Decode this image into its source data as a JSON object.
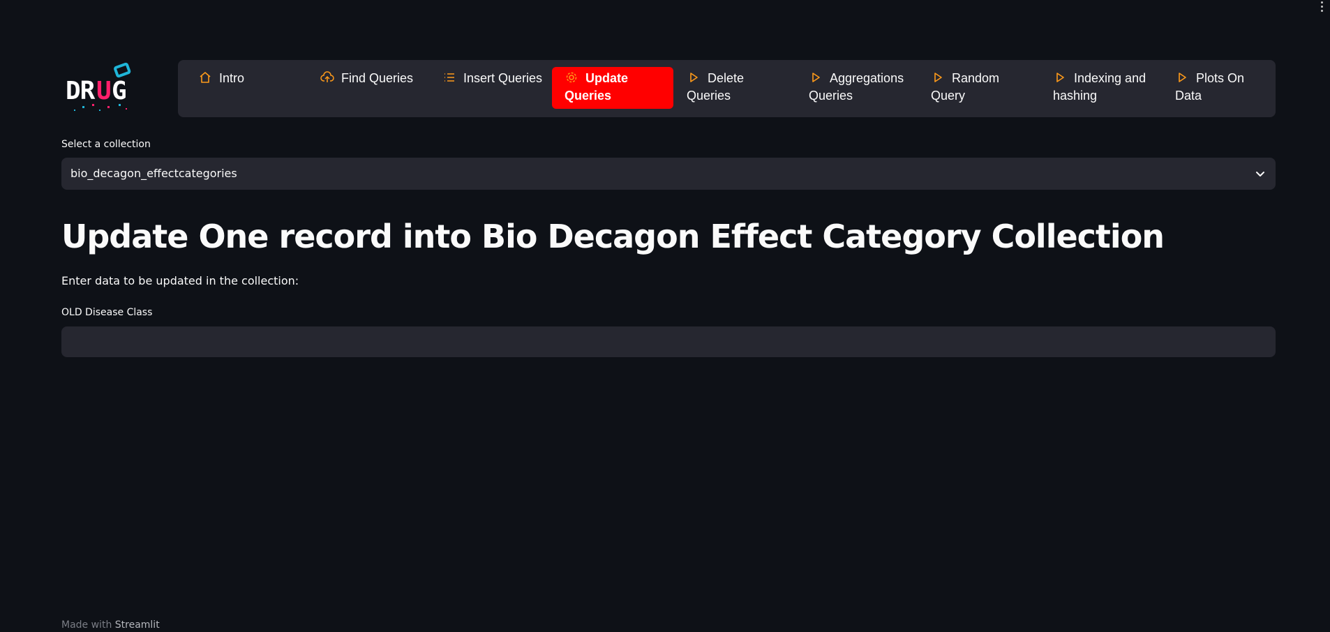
{
  "logo": {
    "text": "DRUG",
    "colors": {
      "main": "#ffffff",
      "accent_u": "#ff1f6b",
      "tag": "#1fb5d8"
    }
  },
  "nav": {
    "items": [
      {
        "label": "Intro",
        "icon": "house-icon",
        "active": false
      },
      {
        "label": "Find Queries",
        "icon": "cloud-upload-icon",
        "active": false
      },
      {
        "label": "Insert Queries",
        "icon": "list-icon",
        "active": false
      },
      {
        "label": "Update Queries",
        "icon": "gear-icon",
        "active": true
      },
      {
        "label": "Delete Queries",
        "icon": "play-icon",
        "active": false
      },
      {
        "label": "Aggregations Queries",
        "icon": "play-icon",
        "active": false
      },
      {
        "label": "Random Query",
        "icon": "play-icon",
        "active": false
      },
      {
        "label": "Indexing and hashing",
        "icon": "play-icon",
        "active": false
      },
      {
        "label": "Plots On Data",
        "icon": "play-icon",
        "active": false
      }
    ],
    "active_color": "#ff0000",
    "icon_color": "#ff9b1a"
  },
  "collection": {
    "label": "Select a collection",
    "selected": "bio_decagon_effectcategories"
  },
  "main": {
    "title": "Update One record into Bio Decagon Effect Category Collection",
    "subtitle": "Enter data to be updated in the collection:",
    "field_label": "OLD Disease Class",
    "field_value": ""
  },
  "footer": {
    "prefix": "Made with",
    "brand": "Streamlit"
  }
}
